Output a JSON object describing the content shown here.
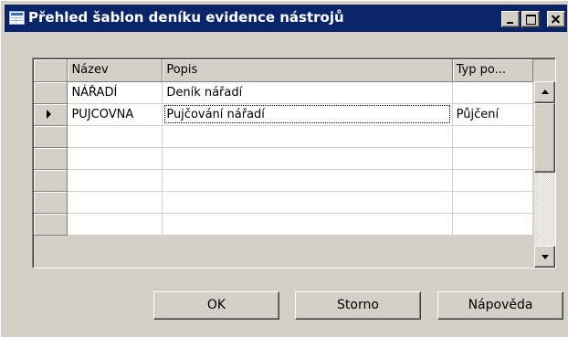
{
  "window": {
    "title": "Přehled šablon deníku evidence nástrojů"
  },
  "colors": {
    "titlebar": "#0a246a",
    "face": "#d4d0c8"
  },
  "grid": {
    "columns": [
      "Název",
      "Popis",
      "Typ po..."
    ],
    "rows": [
      {
        "name": "NÁŘADÍ",
        "description": "Deník nářadí",
        "type": "",
        "current": false
      },
      {
        "name": "PUJCOVNA",
        "description": "Pujčování nářadí",
        "type": "Půjčení",
        "current": true
      },
      {
        "name": "",
        "description": "",
        "type": "",
        "current": false
      },
      {
        "name": "",
        "description": "",
        "type": "",
        "current": false
      },
      {
        "name": "",
        "description": "",
        "type": "",
        "current": false
      },
      {
        "name": "",
        "description": "",
        "type": "",
        "current": false
      },
      {
        "name": "",
        "description": "",
        "type": "",
        "current": false
      }
    ]
  },
  "buttons": {
    "ok": "OK",
    "cancel": "Storno",
    "help": "Nápověda"
  }
}
